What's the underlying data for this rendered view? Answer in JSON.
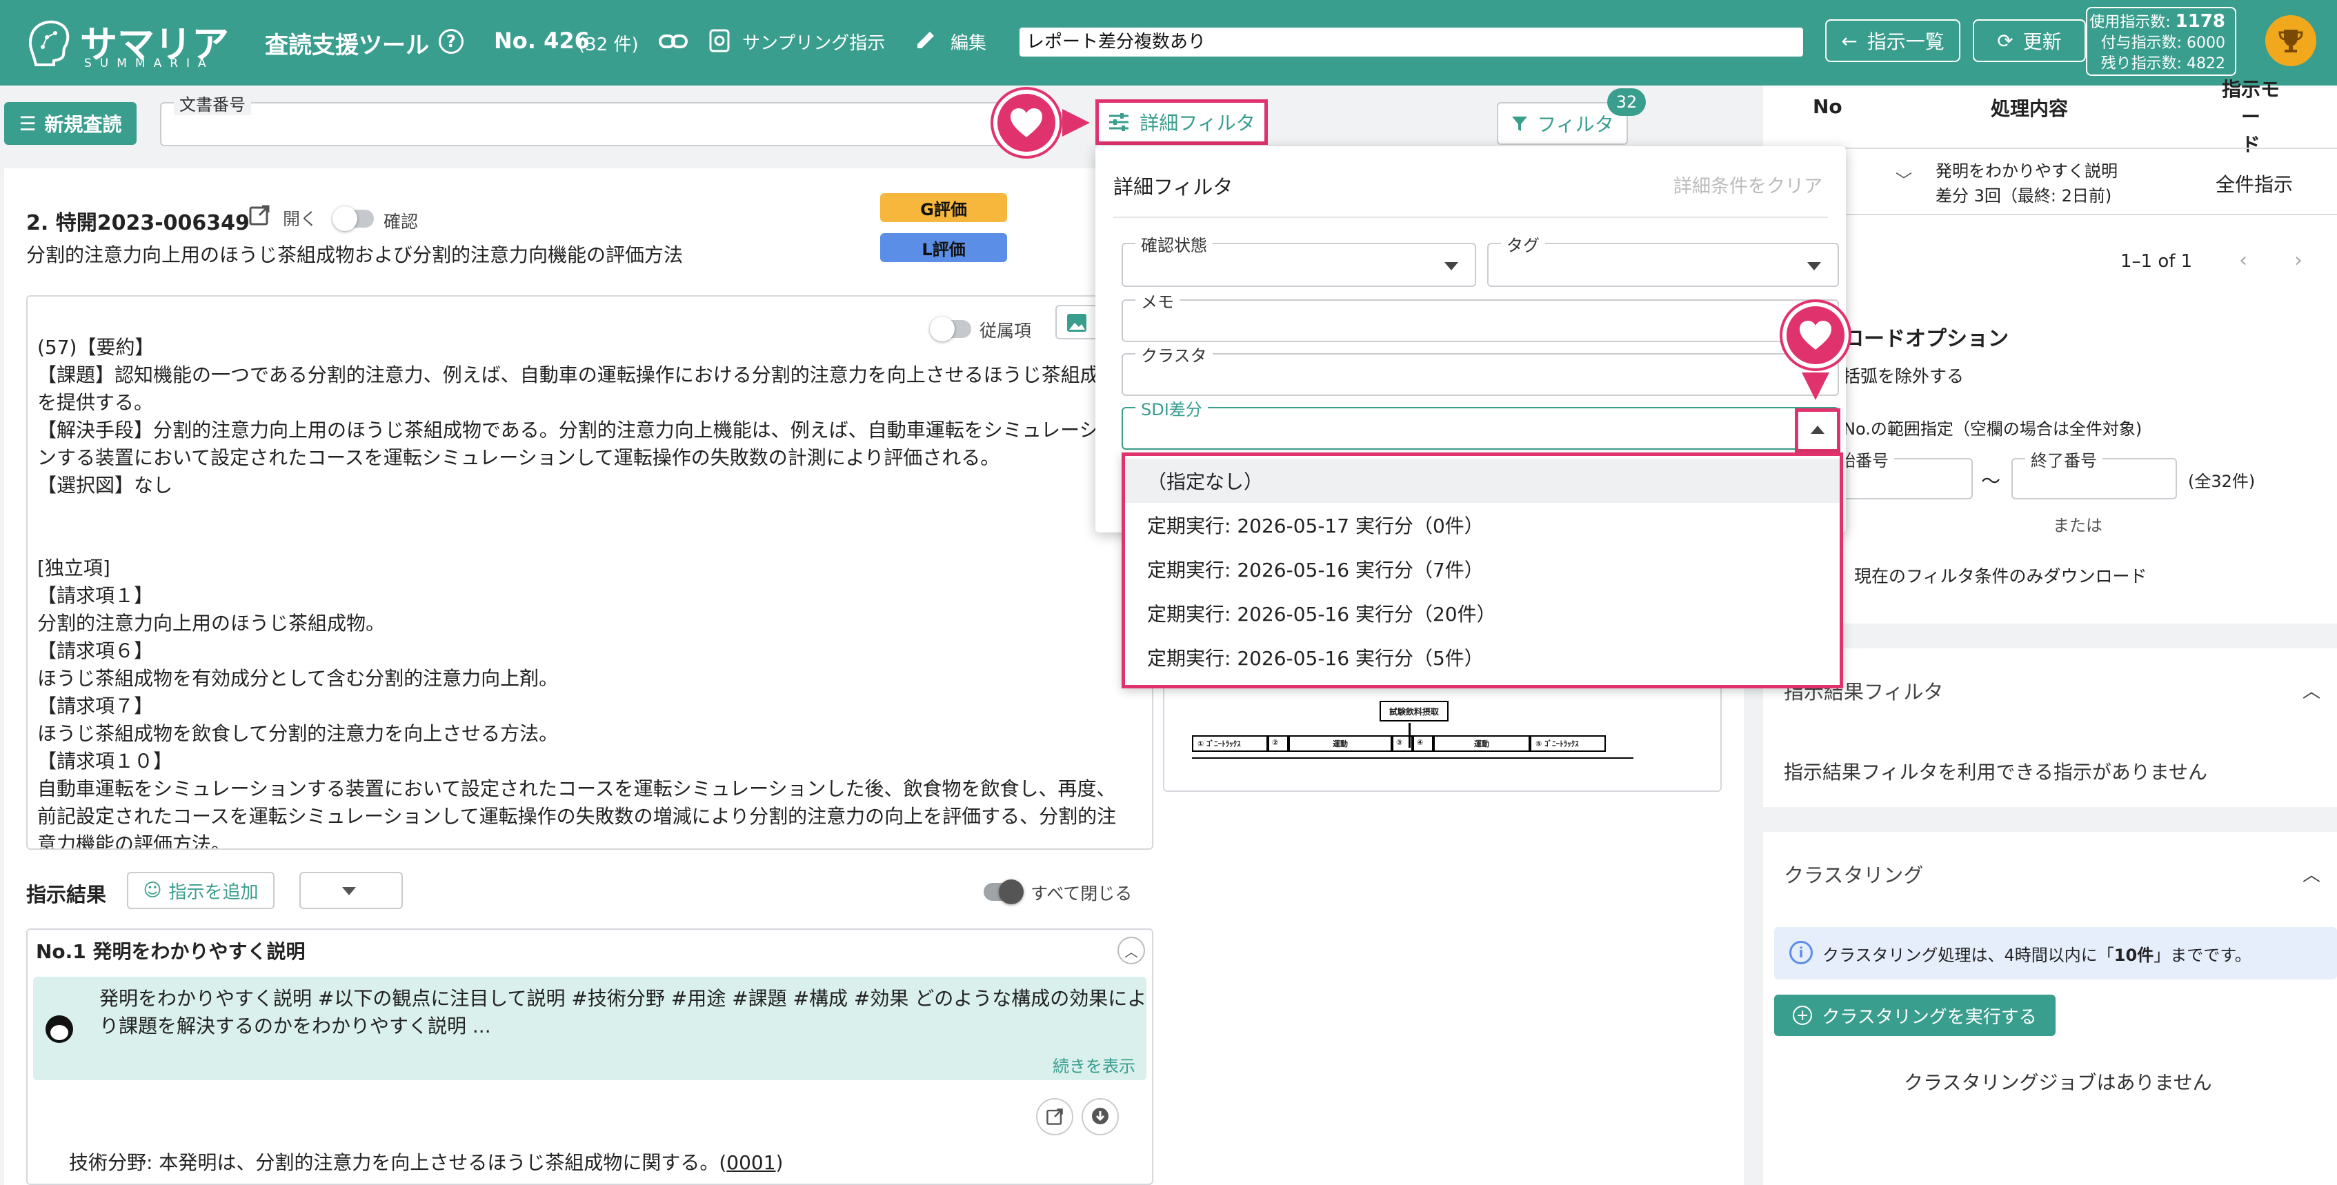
{
  "header": {
    "logo_jp": "サマリア",
    "logo_en": "SUMMARIA",
    "app_title": "査読支援ツール",
    "doc_no": "No. 426",
    "doc_count": "(32 件)",
    "sampling_label": "サンプリング指示",
    "edit_label": "編集",
    "memo_value": "レポート差分複数あり",
    "back_label": "指示一覧",
    "refresh_label": "更新",
    "usage": {
      "used_label": "使用指示数:",
      "used_value": "1178",
      "granted_label": "付与指示数:",
      "granted_value": "6000",
      "remaining_label": "残り指示数:",
      "remaining_value": "4822"
    }
  },
  "toolbar": {
    "new_review_label": "新規査読",
    "doc_number_label": "文書番号",
    "detail_filter_label": "詳細フィルタ",
    "filter_label": "フィルタ",
    "filter_count": "32"
  },
  "document": {
    "title": "2. 特開2023-006349",
    "open_label": "開く",
    "confirm_label": "確認",
    "subtitle": "分割的注意力向上用のほうじ茶組成物および分割的注意力向機能の評価方法",
    "g_badge": "G評価",
    "l_badge": "L評価",
    "dependent_label": "従属項",
    "body_lines": [
      "(57)【要約】",
      "【課題】認知機能の一つである分割的注意力、例えば、自動車の運転操作における分割的注意力を向上させるほうじ茶組成",
      "を提供する。",
      "【解決手段】分割的注意力向上用のほうじ茶組成物である。分割的注意力向上機能は、例えば、自動車運転をシミュレーシ",
      "ンする装置において設定されたコースを運転シミュレーションして運転操作の失敗数の計測により評価される。",
      "【選択図】なし",
      "",
      "",
      "[独立項]",
      "【請求項１】",
      "分割的注意力向上用のほうじ茶組成物。",
      "【請求項６】",
      "ほうじ茶組成物を有効成分として含む分割的注意力向上剤。",
      "【請求項７】",
      "ほうじ茶組成物を飲食して分割的注意力を向上させる方法。",
      "【請求項１０】",
      "自動車運転をシミュレーションする装置において設定されたコースを運転シミュレーションした後、飲食物を飲食し、再度、",
      "前記設定されたコースを運転シミュレーションして運転操作の失敗数の増減により分割的注意力の向上を評価する、分割的注",
      "意力機能の評価方法。"
    ],
    "figure_label": "試験飲料摂取",
    "figure_segments": [
      "① ｺﾞﾆｰﾄﾗｯｸｽ",
      "②",
      "運動",
      "③",
      "④",
      "運動",
      "⑤ ｺﾞﾆｰﾄﾗｯｸｽ"
    ]
  },
  "results": {
    "heading": "指示結果",
    "add_label": "指示を追加",
    "close_all_label": "すべて閉じる",
    "item_title": "No.1 発明をわかりやすく説明",
    "item_prompt_line1": "発明をわかりやすく説明 #以下の観点に注目して説明 #技術分野 #用途 #課題 #構成 #効果 どのような構成の効果によ",
    "item_prompt_line2": "り課題を解決するのかをわかりやすく説明 ...",
    "show_more": "続きを表示",
    "answer_prefix": "技術分野: 本発明は、分割的注意力を向上させるほうじ茶組成物に関する。(",
    "answer_link": "0001",
    "answer_suffix": ")"
  },
  "detail_filter": {
    "title": "詳細フィルタ",
    "clear_label": "詳細条件をクリア",
    "status_label": "確認状態",
    "tag_label": "タグ",
    "memo_label": "メモ",
    "cluster_label": "クラスタ",
    "sdi_label": "SDI差分",
    "options": [
      "（指定なし）",
      "定期実行: 2026-05-17 実行分（0件）",
      "定期実行: 2026-05-16 実行分（7件）",
      "定期実行: 2026-05-16 実行分（20件）",
      "定期実行: 2026-05-16 実行分（5件）"
    ]
  },
  "right_panel": {
    "col_no": "No",
    "col_process": "処理内容",
    "col_mode": "指示モー\nド",
    "row_title": "発明をわかりやすく説明",
    "row_sub": "差分 3回（最終: 2日前)",
    "row_mode": "全件指示",
    "pagination": "1–1 of 1",
    "dl_title": "ロードオプション",
    "dl_exclude": "括弧を除外する",
    "dl_range": "No.の範囲指定（空欄の場合は全件対象)",
    "dl_start": "始番号",
    "dl_end": "終了番号",
    "dl_tilde": "〜",
    "dl_total": "(全32件)",
    "dl_or": "または",
    "dl_current": "現在のフィルタ条件のみダウンロード",
    "result_filter_title": "指示結果フィルタ",
    "result_filter_msg": "指示結果フィルタを利用できる指示がありません",
    "cluster_title": "クラスタリング",
    "cluster_info_prefix": "クラスタリング処理は、4時間以内に「",
    "cluster_info_bold": "10件",
    "cluster_info_suffix": "」までです。",
    "cluster_run": "クラスタリングを実行する",
    "cluster_empty": "クラスタリングジョブはありません"
  },
  "colors": {
    "primary": "#3a9e8e",
    "highlight": "#e0336e",
    "g_badge": "#f6b73c",
    "l_badge": "#5b8ee6"
  }
}
